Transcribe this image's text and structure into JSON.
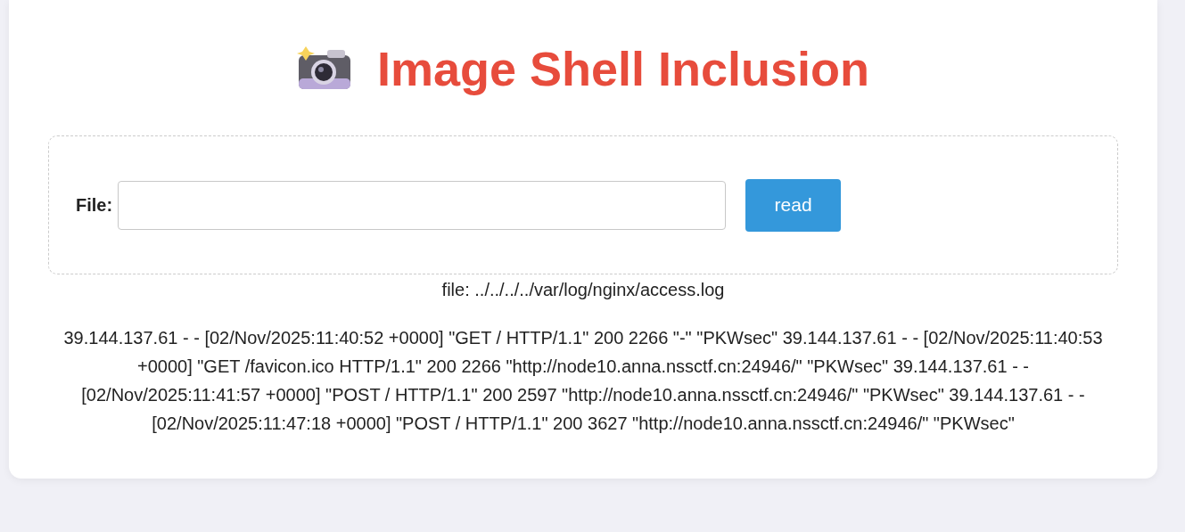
{
  "title": "Image Shell Inclusion",
  "form": {
    "label": "File:",
    "button": "read"
  },
  "file_line": "file: ../../../../var/log/nginx/access.log",
  "output": "39.144.137.61 - - [02/Nov/2025:11:40:52 +0000] \"GET / HTTP/1.1\" 200 2266 \"-\" \"PKWsec\" 39.144.137.61 - - [02/Nov/2025:11:40:53 +0000] \"GET /favicon.ico HTTP/1.1\" 200 2266 \"http://node10.anna.nssctf.cn:24946/\" \"PKWsec\" 39.144.137.61 - - [02/Nov/2025:11:41:57 +0000] \"POST / HTTP/1.1\" 200 2597 \"http://node10.anna.nssctf.cn:24946/\" \"PKWsec\" 39.144.137.61 - - [02/Nov/2025:11:47:18 +0000] \"POST / HTTP/1.1\" 200 3627 \"http://node10.anna.nssctf.cn:24946/\" \"PKWsec\""
}
